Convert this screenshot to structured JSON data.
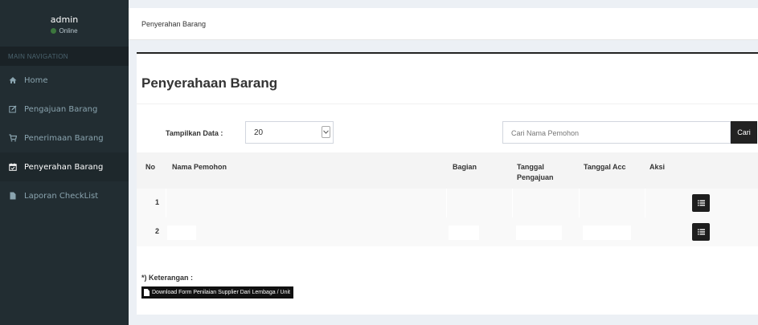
{
  "user": {
    "name": "admin",
    "status": "Online"
  },
  "sidebar": {
    "header": "MAIN NAVIGATION",
    "items": [
      {
        "label": "Home",
        "icon": "home-icon"
      },
      {
        "label": "Pengajuan Barang",
        "icon": "edit-icon"
      },
      {
        "label": "Penerimaan Barang",
        "icon": "cart-icon"
      },
      {
        "label": "Penyerahan Barang",
        "icon": "calendar-icon",
        "active": true
      },
      {
        "label": "Laporan CheckList",
        "icon": "file-icon"
      }
    ]
  },
  "breadcrumb": "Penyerahan Barang",
  "box": {
    "title": "Penyerahaan Barang"
  },
  "filters": {
    "show_label": "Tampilkan Data :",
    "show_value": "20",
    "search_placeholder": "Cari Nama Pemohon",
    "search_button": "Cari"
  },
  "table": {
    "columns": [
      "No",
      "Nama Pemohon",
      "Bagian",
      "Tanggal Pengajuan",
      "Tanggal Acc",
      "Aksi"
    ],
    "rows": [
      {
        "no": "1"
      },
      {
        "no": "2"
      }
    ]
  },
  "note": {
    "label": "*) Keterangan :",
    "download": "Download Form Penilaian Supplier Dari Lembaga / Unit"
  },
  "colors": {
    "sidebar": "#222d32",
    "accent": "#222222"
  }
}
